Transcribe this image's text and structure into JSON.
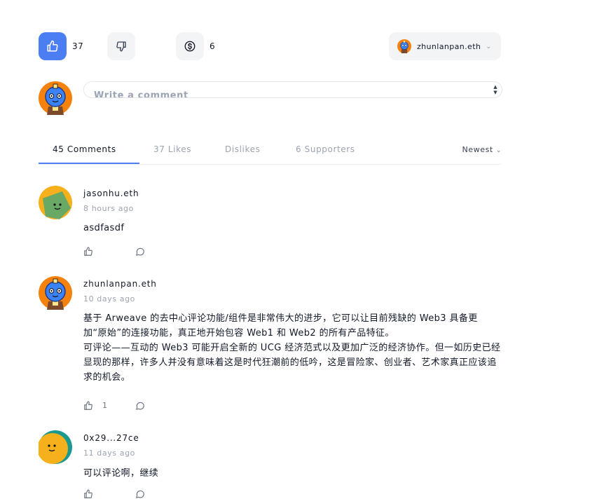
{
  "actions": {
    "likes_count": "37",
    "supporters_count": "6",
    "wallet_name": "zhunlanpan.eth"
  },
  "composer": {
    "placeholder": "Write a comment"
  },
  "tabs": [
    {
      "label": "45 Comments",
      "active": true
    },
    {
      "label": "37 Likes",
      "active": false
    },
    {
      "label": "Dislikes",
      "active": false
    },
    {
      "label": "6 Supporters",
      "active": false
    }
  ],
  "sort": {
    "label": "Newest"
  },
  "comments": [
    {
      "author": "jasonhu.eth",
      "time": "8 hours ago",
      "body": "asdfasdf",
      "likes": ""
    },
    {
      "author": "zhunlanpan.eth",
      "time": "10 days ago",
      "body": "基于 Arweave 的去中心评论功能/组件是非常伟大的进步，它可以让目前残缺的 Web3 具备更加“原始”的连接功能，真正地开始包容 Web1 和 Web2 的所有产品特征。\n可评论——互动的 Web3 可能开启全新的 UCG 经济范式以及更加广泛的经济协作。但一如历史已经显现的那样，许多人并没有意味着这是时代狂潮前的低吟，这是冒险家、创业者、艺术家真正应该追求的机会。",
      "likes": "1"
    },
    {
      "author": "0x29...27ce",
      "time": "11 days ago",
      "body": "可以评论啊，继续",
      "likes": ""
    }
  ],
  "colors": {
    "accent": "#4c7ef3",
    "muted": "#9ca3af",
    "border": "#e5e7eb"
  }
}
